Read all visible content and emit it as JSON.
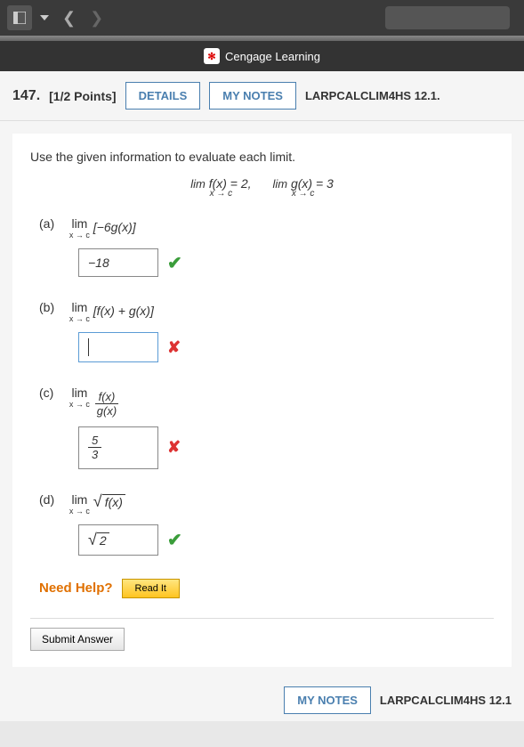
{
  "header": {
    "brand": "Cengage Learning"
  },
  "question": {
    "number": "147.",
    "points": "[1/2 Points]",
    "details_btn": "DETAILS",
    "notes_btn": "MY NOTES",
    "reference": "LARPCALCLIM4HS 12.1.",
    "prompt": "Use the given information to evaluate each limit.",
    "given_f_lim": "lim",
    "given_f_sub": "x → c",
    "given_f_expr": "f(x) = 2,",
    "given_g_lim": "lim",
    "given_g_sub": "x → c",
    "given_g_expr": "g(x) = 3"
  },
  "parts": {
    "a": {
      "label": "(a)",
      "expr": "[−6g(x)]",
      "answer": "−18",
      "status": "correct"
    },
    "b": {
      "label": "(b)",
      "expr": "[f(x) + g(x)]",
      "answer": "",
      "status": "incorrect"
    },
    "c": {
      "label": "(c)",
      "frac_top": "f(x)",
      "frac_bot": "g(x)",
      "ans_top": "5",
      "ans_bot": "3",
      "status": "incorrect"
    },
    "d": {
      "label": "(d)",
      "sqrt_arg": "f(x)",
      "ans_sqrt": "2",
      "status": "correct"
    }
  },
  "lim": {
    "top": "lim",
    "bot": "x → c"
  },
  "help": {
    "label": "Need Help?",
    "read_it": "Read It"
  },
  "submit": {
    "label": "Submit Answer"
  },
  "bottom": {
    "notes": "MY NOTES",
    "ref": "LARPCALCLIM4HS 12.1"
  }
}
